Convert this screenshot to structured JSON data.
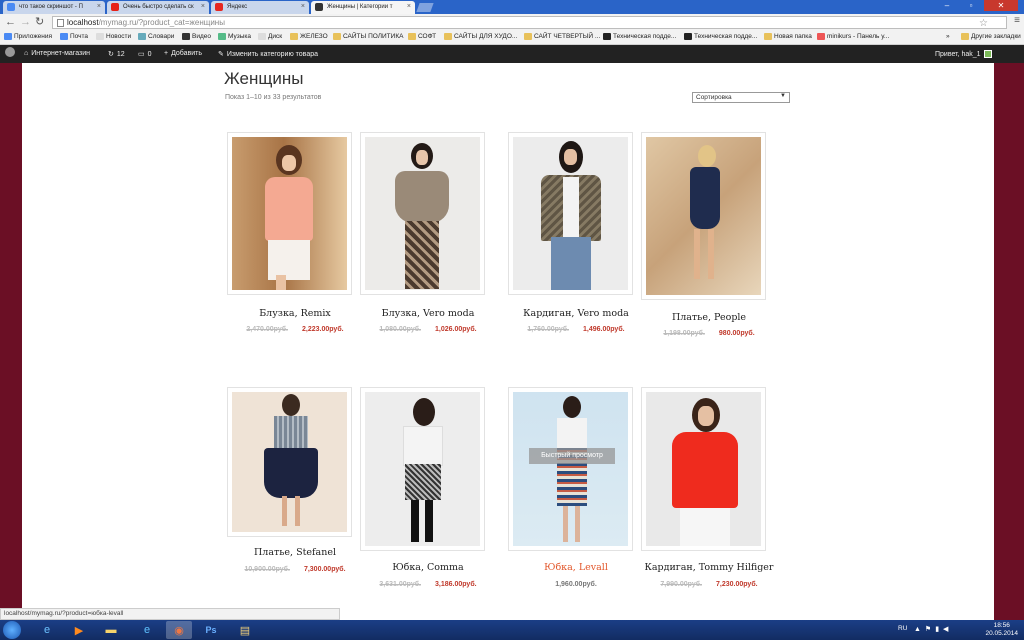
{
  "browser": {
    "tabs": [
      {
        "title": "что такое скриншот - П",
        "icon_color": "#4a8af4"
      },
      {
        "title": "Очень быстро сделать ск",
        "icon_color": "#e62117"
      },
      {
        "title": "Яндекс",
        "icon_color": "#e52620"
      },
      {
        "title": "Женщины | Категории т",
        "icon_color": "#333333"
      }
    ],
    "url_host": "localhost",
    "url_path": "/mymag.ru/?product_cat=женщины",
    "back": "←",
    "forward": "→",
    "reload": "↻",
    "star": "☆",
    "menu": "≡"
  },
  "bookmarks": {
    "items": [
      "Приложения",
      "Почта",
      "Новости",
      "Словари",
      "Видео",
      "Музыка",
      "Диск",
      "ЖЕЛЕЗО",
      "САЙТЫ ПОЛИТИКА",
      "СОФТ",
      "САЙТЫ ДЛЯ ХУДО...",
      "САЙТ ЧЕТВЕРТЫЙ ...",
      "Техническая подде...",
      "Техническая подде...",
      "Новая папка",
      "minikurs - Панель у..."
    ],
    "overflow": "»",
    "other": "Другие закладки"
  },
  "wpbar": {
    "site": "Интернет-магазин",
    "updates": "12",
    "comments": "0",
    "add": "Добавить",
    "edit": "Изменить категорию товара",
    "greeting": "Привет, hak_1"
  },
  "page": {
    "title": "Женщины",
    "results": "Показ 1–10 из 33 результатов",
    "sort_label": "Сортировка",
    "quickview": "Быстрый просмотр"
  },
  "products": [
    {
      "name": "Блузка, Remix",
      "old": "2,470.00руб.",
      "new": "2,223.00руб."
    },
    {
      "name": "Блузка, Vero moda",
      "old": "1,080.00руб.",
      "new": "1,026.00руб."
    },
    {
      "name": "Кардиган, Vero moda",
      "old": "1,760.00руб.",
      "new": "1,496.00руб."
    },
    {
      "name": "Платье, People",
      "old": "1,198.00руб.",
      "new": "980.00руб."
    },
    {
      "name": "Платье, Stefanel",
      "old": "10,900.00руб.",
      "new": "7,300.00руб."
    },
    {
      "name": "Юбка, Comma",
      "old": "3,631.00руб.",
      "new": "3,186.00руб."
    },
    {
      "name": "Юбка, Levall",
      "single": "1,960.00руб."
    },
    {
      "name": "Кардиган, Tommy Hilfiger",
      "old": "7,990.00руб.",
      "new": "7,230.00руб."
    }
  ],
  "statusbar": "localhost/mymag.ru/?product=юбка-levall",
  "taskbar": {
    "lang": "RU",
    "time": "18:56",
    "date": "20.05.2014"
  },
  "colors": {
    "accent": "#6b0f25",
    "price_new": "#c0392b",
    "hover_name": "#e2562a"
  }
}
